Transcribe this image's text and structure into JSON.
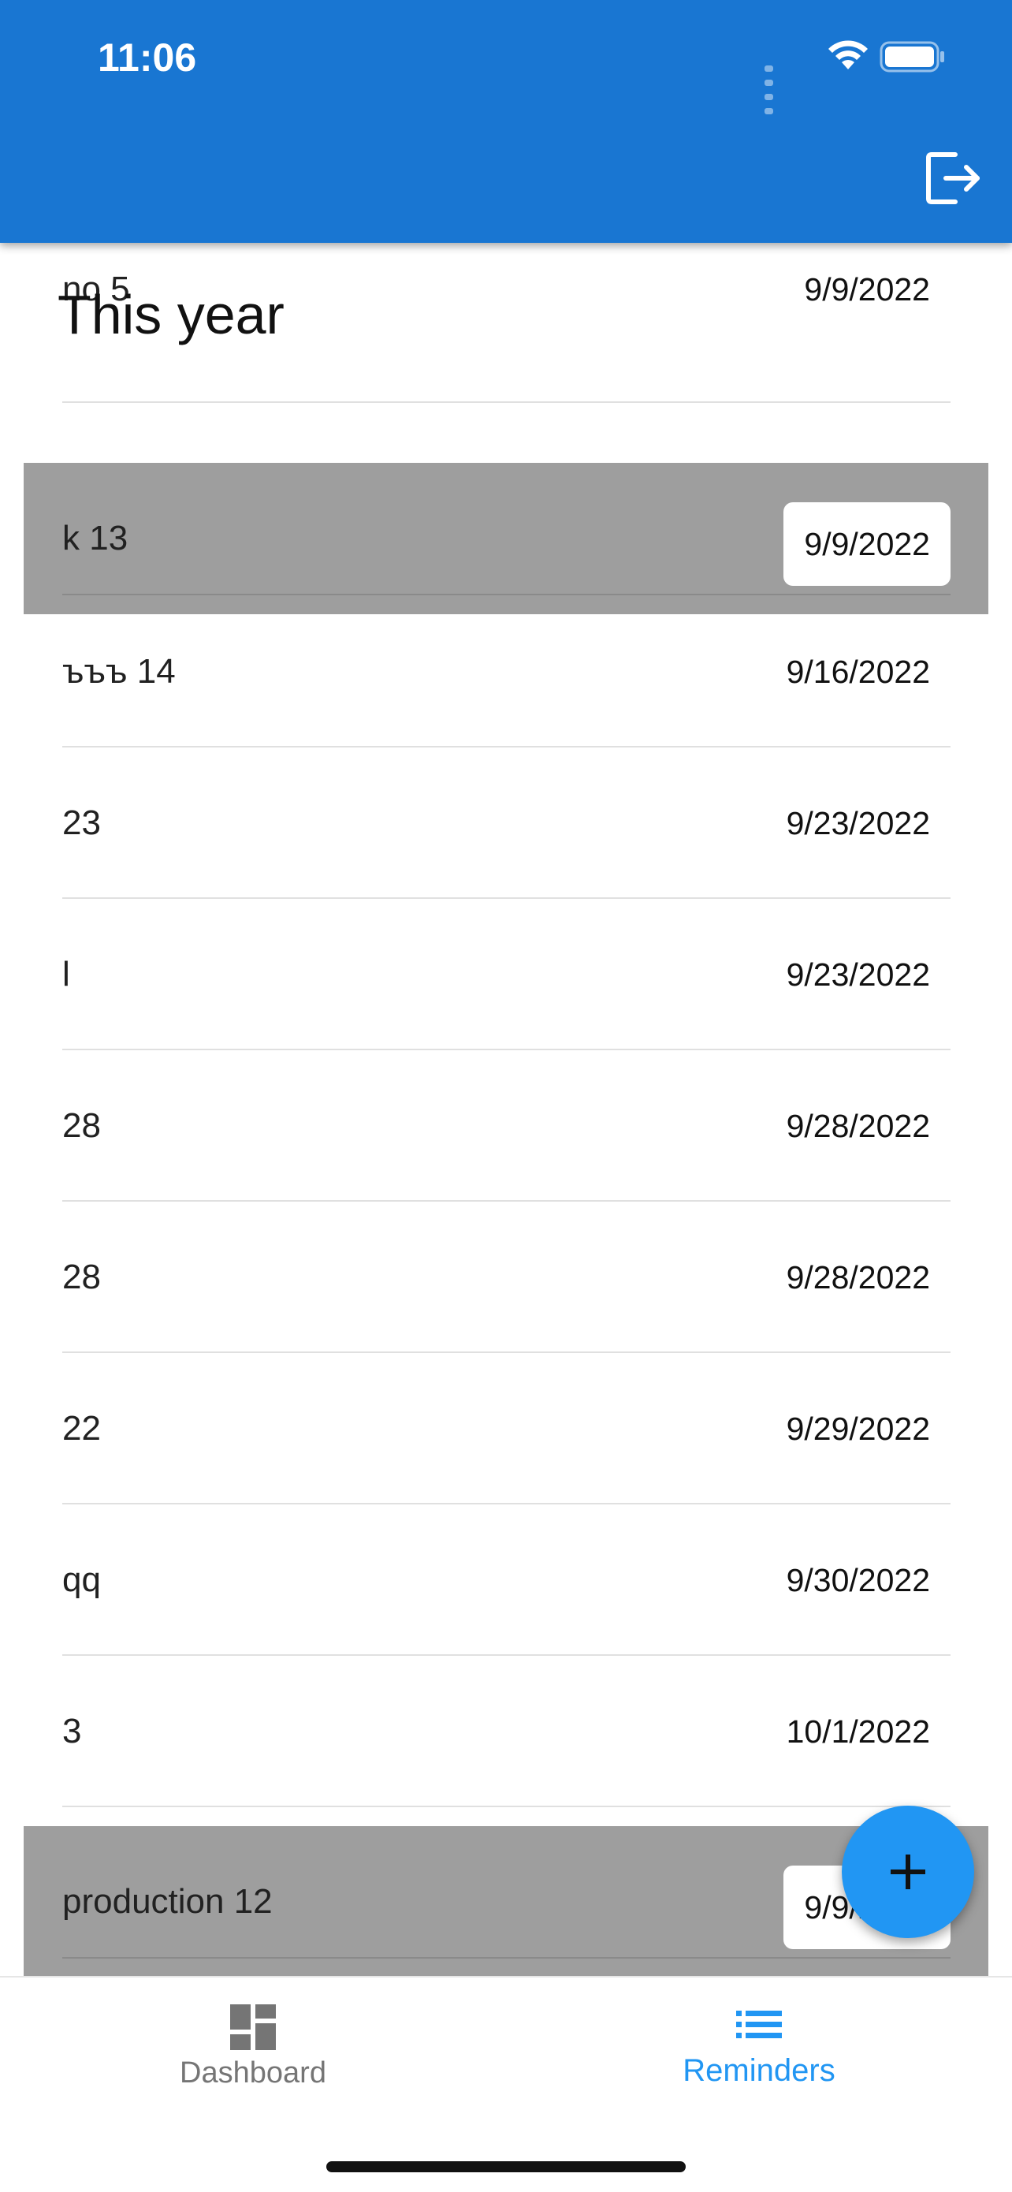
{
  "status_bar": {
    "time": "11:06"
  },
  "app_bar": {
    "logout_icon": "logout-icon",
    "color": "#1976D2"
  },
  "section": {
    "title": "This year"
  },
  "reminders": [
    {
      "title": "no 5",
      "date": "9/9/2022",
      "selected": false
    },
    {
      "title": "k 13",
      "date": "9/9/2022",
      "selected": true
    },
    {
      "title": "ъъъ 14",
      "date": "9/16/2022",
      "selected": false
    },
    {
      "title": "23",
      "date": "9/23/2022",
      "selected": false
    },
    {
      "title": "l",
      "date": "9/23/2022",
      "selected": false
    },
    {
      "title": "28",
      "date": "9/28/2022",
      "selected": false
    },
    {
      "title": "28",
      "date": "9/28/2022",
      "selected": false
    },
    {
      "title": "22",
      "date": "9/29/2022",
      "selected": false
    },
    {
      "title": "qq",
      "date": "9/30/2022",
      "selected": false
    },
    {
      "title": "3",
      "date": "10/1/2022",
      "selected": false
    },
    {
      "title": "production 12",
      "date": "9/9/2022",
      "selected": true
    }
  ],
  "fab": {
    "icon": "plus-icon",
    "color": "#2196F3"
  },
  "bottom_nav": {
    "items": [
      {
        "label": "Dashboard",
        "icon": "dashboard-icon",
        "active": false
      },
      {
        "label": "Reminders",
        "icon": "list-icon",
        "active": true
      }
    ],
    "active_color": "#2196F3",
    "inactive_color": "#757575"
  }
}
